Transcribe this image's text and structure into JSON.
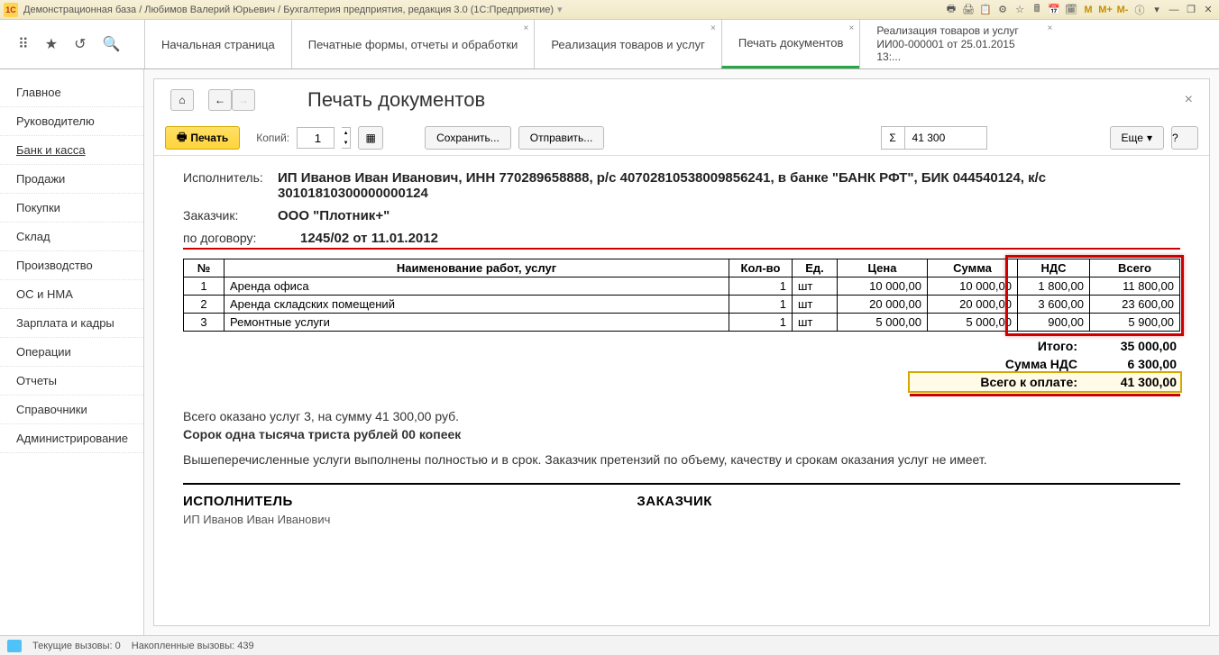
{
  "title": "Демонстрационная база / Любимов Валерий Юрьевич / Бухгалтерия предприятия, редакция 3.0  (1С:Предприятие)",
  "win_icons": [
    "🖶",
    "🖨",
    "📋",
    "⚙",
    "☆",
    "🖩",
    "📅",
    "🗓",
    "M",
    "M+",
    "M-",
    "ⓘ",
    "▾",
    "—",
    "❐",
    "✕"
  ],
  "tabs": [
    {
      "label": "Начальная страница"
    },
    {
      "label": "Печатные формы, отчеты и обработки"
    },
    {
      "label": "Реализация товаров и услуг"
    },
    {
      "label": "Печать документов",
      "active": true
    },
    {
      "label": "Реализация товаров и услуг ИИ00-000001 от 25.01.2015 13:..."
    }
  ],
  "sidebar": [
    "Главное",
    "Руководителю",
    "Банк и касса",
    "Продажи",
    "Покупки",
    "Склад",
    "Производство",
    "ОС и НМА",
    "Зарплата и кадры",
    "Операции",
    "Отчеты",
    "Справочники",
    "Администрирование"
  ],
  "sidebar_active": 2,
  "page_title": "Печать документов",
  "toolbar": {
    "print": "Печать",
    "copies_label": "Копий:",
    "copies_value": "1",
    "save": "Сохранить...",
    "send": "Отправить...",
    "sum": "41 300",
    "more": "Еще",
    "help": "?"
  },
  "doc": {
    "executor_label": "Исполнитель:",
    "executor": "ИП Иванов Иван Иванович, ИНН 770289658888, р/с 40702810538009856241, в банке \"БАНК РФТ\", БИК 044540124, к/с 30101810300000000124",
    "customer_label": "Заказчик:",
    "customer": "ООО \"Плотник+\"",
    "contract_label": "по договору:",
    "contract": "1245/02 от 11.01.2012",
    "headers": [
      "№",
      "Наименование работ, услуг",
      "Кол-во",
      "Ед.",
      "Цена",
      "Сумма",
      "НДС",
      "Всего"
    ],
    "rows": [
      {
        "n": "1",
        "name": "Аренда офиса",
        "qty": "1",
        "unit": "шт",
        "price": "10 000,00",
        "sum": "10 000,00",
        "vat": "1 800,00",
        "total": "11 800,00"
      },
      {
        "n": "2",
        "name": "Аренда складских помещений",
        "qty": "1",
        "unit": "шт",
        "price": "20 000,00",
        "sum": "20 000,00",
        "vat": "3 600,00",
        "total": "23 600,00"
      },
      {
        "n": "3",
        "name": "Ремонтные услуги",
        "qty": "1",
        "unit": "шт",
        "price": "5 000,00",
        "sum": "5 000,00",
        "vat": "900,00",
        "total": "5 900,00"
      }
    ],
    "totals": {
      "itogo_l": "Итого:",
      "itogo_v": "35 000,00",
      "vat_l": "Сумма НДС",
      "vat_v": "6 300,00",
      "pay_l": "Всего к оплате:",
      "pay_v": "41 300,00"
    },
    "summary1": "Всего оказано услуг 3, на сумму 41 300,00 руб.",
    "summary2": "Сорок одна тысяча триста рублей 00 копеек",
    "summary3": "Вышеперечисленные услуги выполнены полностью и в срок. Заказчик претензий по объему, качеству и срокам оказания услуг не имеет.",
    "exec_t": "ИСПОЛНИТЕЛЬ",
    "exec_sub": "ИП Иванов Иван Иванович",
    "cust_t": "ЗАКАЗЧИК"
  },
  "status": {
    "calls": "Текущие вызовы: 0",
    "acc": "Накопленные вызовы: 439"
  }
}
